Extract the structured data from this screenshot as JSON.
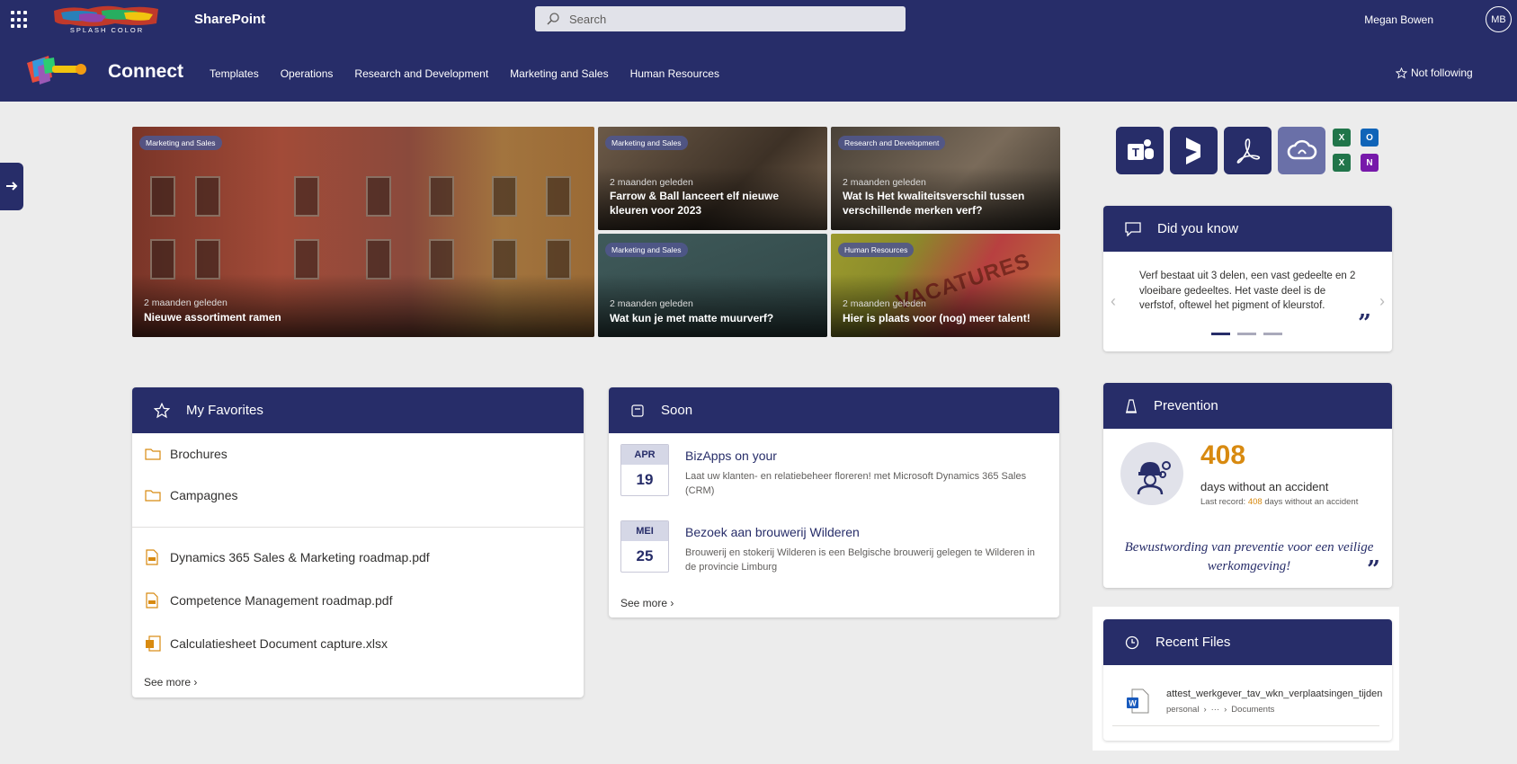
{
  "suite": {
    "app_name": "SharePoint",
    "brand_lines": "SPLASH COLOR",
    "search_placeholder": "Search",
    "user_name": "Megan Bowen",
    "user_initials": "MB"
  },
  "site": {
    "title": "Connect",
    "nav": [
      "Templates",
      "Operations",
      "Research and Development",
      "Marketing and Sales",
      "Human Resources"
    ],
    "follow_label": "Not following"
  },
  "news": [
    {
      "tag": "Marketing and Sales",
      "time": "2 maanden geleden",
      "title": "Nieuwe assortiment ramen"
    },
    {
      "tag": "Marketing and Sales",
      "time": "2 maanden geleden",
      "title": "Farrow & Ball lanceert elf nieuwe kleuren voor 2023"
    },
    {
      "tag": "Research and Development",
      "time": "2 maanden geleden",
      "title": "Wat Is Het kwaliteitsverschil tussen verschillende merken verf?"
    },
    {
      "tag": "Marketing and Sales",
      "time": "2 maanden geleden",
      "title": "Wat kun je met matte muurverf?"
    },
    {
      "tag": "Human Resources",
      "time": "2 maanden geleden",
      "title": "Hier is plaats voor (nog) meer talent!"
    }
  ],
  "tile5_image_text": "VACATURES",
  "quick_apps": [
    "teams-icon",
    "dynamics-icon",
    "acrobat-icon",
    "creative-cloud-icon"
  ],
  "mini_apps": [
    "excel-icon",
    "outlook-icon",
    "excel-icon",
    "onenote-icon"
  ],
  "did_you_know": {
    "title": "Did you know",
    "text": "Verf bestaat uit 3 delen, een vast gedeelte en 2 vloeibare gedeeltes. Het vaste deel is de verfstof, oftewel het pigment of kleurstof.",
    "quote_mark": "”"
  },
  "favorites": {
    "title": "My Favorites",
    "folders": [
      "Brochures",
      "Campagnes"
    ],
    "files": [
      "Dynamics 365 Sales & Marketing roadmap.pdf",
      "Competence Management roadmap.pdf",
      "Calculatiesheet Document capture.xlsx"
    ],
    "see_more": "See more"
  },
  "soon": {
    "title": "Soon",
    "events": [
      {
        "month": "APR",
        "day": "19",
        "title": "BizApps on your",
        "desc": "Laat uw klanten- en relatiebeheer floreren! met Microsoft Dynamics 365 Sales (CRM)"
      },
      {
        "month": "MEI",
        "day": "25",
        "title": "Bezoek aan brouwerij Wilderen",
        "desc": "Brouwerij en stokerij Wilderen is een Belgische brouwerij gelegen te Wilderen in de provincie Limburg"
      }
    ],
    "see_more": "See more"
  },
  "prevention": {
    "title": "Prevention",
    "count": "408",
    "days_label": "days without an accident",
    "last_prefix": "Last record:",
    "last_value": "408",
    "last_suffix": "days without an accident",
    "motto": "Bewustwording van preventie voor een veilige werkomgeving!",
    "quote_mark": "”"
  },
  "recent_files": {
    "title": "Recent Files",
    "file_name": "attest_werkgever_tav_wkn_verplaatsingen_tijdens_lockdown",
    "path": [
      "personal",
      "···",
      "Documents"
    ]
  },
  "colors": {
    "brand_navy": "#272d69",
    "accent_orange": "#d88a10"
  }
}
